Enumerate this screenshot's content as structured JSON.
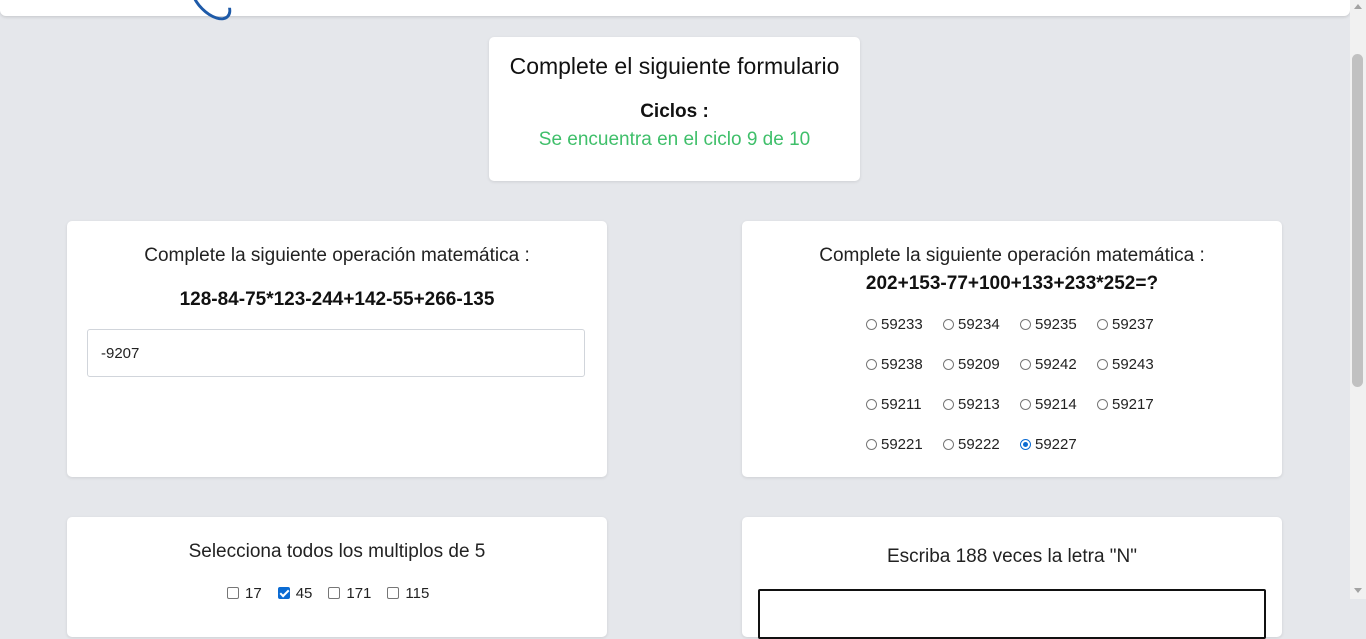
{
  "header": {
    "title": "Complete el siguiente formulario",
    "cycles_label": "Ciclos :",
    "cycles_status": "Se encuentra en el ciclo 9 de 10"
  },
  "question1": {
    "title": "Complete la siguiente operación matemática :",
    "expression": "128-84-75*123-244+142-55+266-135",
    "answer_value": "-9207"
  },
  "question2": {
    "title": "Complete la siguiente operación matemática :",
    "expression": "202+153-77+100+133+233*252=?",
    "options": [
      [
        "59233",
        "59234",
        "59235",
        "59237"
      ],
      [
        "59238",
        "59209",
        "59242",
        "59243"
      ],
      [
        "59211",
        "59213",
        "59214",
        "59217"
      ],
      [
        "59221",
        "59222",
        "59227"
      ]
    ],
    "selected": "59227"
  },
  "question3": {
    "title": "Selecciona todos los multiplos de 5",
    "options": [
      "17",
      "45",
      "171",
      "115"
    ],
    "checked": [
      "45"
    ]
  },
  "question4": {
    "title": "Escriba 188 veces la letra \"N\"",
    "text_value": ""
  },
  "colors": {
    "background": "#e5e7eb",
    "status_green": "#3fbf6a",
    "accent_blue": "#0b6bd3",
    "logo_blue": "#1e5aa8"
  }
}
